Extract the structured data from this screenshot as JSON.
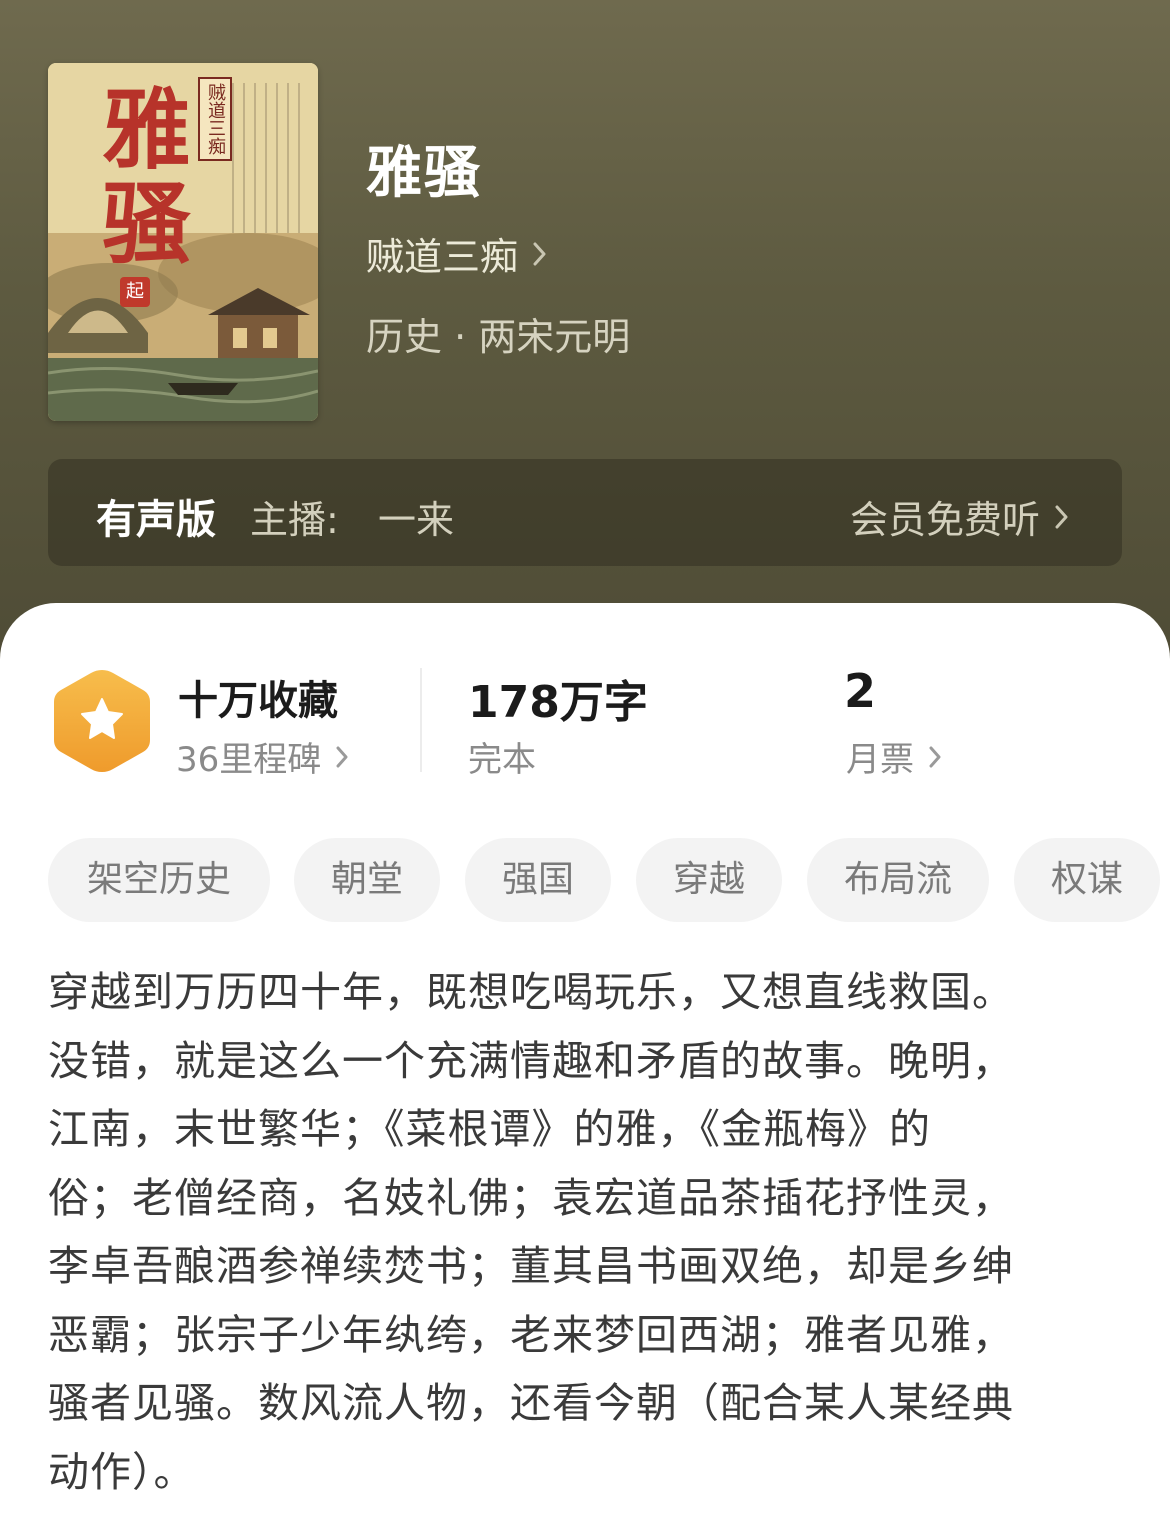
{
  "book": {
    "title": "雅骚",
    "author": "贼道三痴",
    "genre": "历史 · 两宋元明",
    "cover": {
      "title_text": "雅骚",
      "author_text": "贼道三痴",
      "badge_text": "起"
    }
  },
  "audio": {
    "label": "有声版",
    "host_label": "主播:",
    "host_name": "一来",
    "action": "会员免费听"
  },
  "stats": {
    "favorites": "十万收藏",
    "milestones": "36里程碑",
    "word_count": "178万字",
    "status": "完本",
    "monthly_votes_value": "2",
    "monthly_votes_label": "月票"
  },
  "tags": [
    "架空历史",
    "朝堂",
    "强国",
    "穿越",
    "布局流",
    "权谋"
  ],
  "description": [
    "穿越到万历四十年，既想吃喝玩乐，又想直线救国。",
    "没错，就是这么一个充满情趣和矛盾的故事。晚明，",
    "江南，末世繁华；《菜根谭》的雅，《金瓶梅》的",
    "俗；老僧经商，名妓礼佛；袁宏道品茶插花抒性灵，",
    "李卓吾酿酒参禅续焚书；董其昌书画双绝，却是乡绅",
    "恶霸；张宗子少年纨绔，老来梦回西湖；雅者见雅，",
    "骚者见骚。数风流人物，还看今朝（配合某人某经典",
    "动作）。"
  ],
  "colors": {
    "hero_bg": "#5d5a40",
    "badge_orange": "#f3a93a",
    "text_dark": "#1b1b1b",
    "text_muted": "#8a8a8a",
    "tag_bg": "#f3f3f3"
  }
}
